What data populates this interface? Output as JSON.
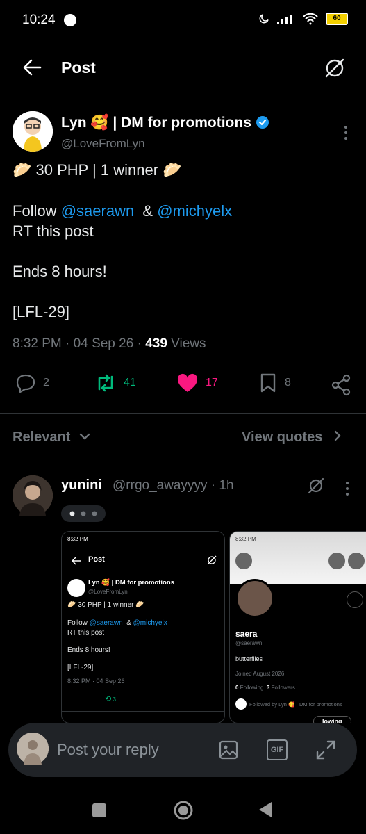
{
  "status": {
    "time": "10:24",
    "battery": "60"
  },
  "header": {
    "title": "Post"
  },
  "post": {
    "author_name": "Lyn 🥰 | DM for promotions",
    "author_handle": "@LoveFromLyn",
    "line1": "🥟 30 PHP | 1 winner 🥟",
    "follow_prefix": "Follow ",
    "mention1": "@saerawn",
    "follow_amp": "  & ",
    "mention2": "@michyelx",
    "line3": "RT this post",
    "line4": "Ends 8 hours!",
    "line5": "[LFL-29]",
    "time": "8:32 PM",
    "date": "04 Sep 26",
    "views_count": "439",
    "views_label": " Views",
    "meta_sep": " · ",
    "replies": "2",
    "reposts": "41",
    "likes": "17",
    "bookmarks": "8"
  },
  "filter": {
    "relevant": "Relevant",
    "view_quotes": "View quotes"
  },
  "reply": {
    "name": "yunini",
    "handle": "@rrgo_awayyyy · 1h"
  },
  "shot1": {
    "status_time": "8:32 PM",
    "title": "Post",
    "author": "Lyn 🥰 | DM for promotions",
    "handle": "@LoveFromLyn",
    "line1": "🥟 30 PHP | 1 winner 🥟",
    "follow": "Follow ",
    "m1": "@saerawn",
    "amp": "  & ",
    "m2": "@michyelx",
    "line3": "RT this post",
    "line4": "Ends 8 hours!",
    "line5": "[LFL-29]",
    "meta": "8:32 PM · 04 Sep 26",
    "reposts": "3"
  },
  "shot2": {
    "status_time": "8:32 PM",
    "name": "saera",
    "handle": "@saerawn",
    "bio": "butterflies",
    "joined": "Joined August 2026",
    "following_count": "0",
    "following_label": " Following  ",
    "followers_count": "3",
    "followers_label": " Followers",
    "followed_by": "Followed by Lyn 🥰 · DM for promotions",
    "button": "lowing"
  },
  "composer": {
    "placeholder": "Post your reply",
    "gif": "GIF"
  },
  "colors": {
    "accent": "#1d9bf0",
    "repost": "#00ba7c",
    "like": "#f91880",
    "muted": "#71767b"
  }
}
